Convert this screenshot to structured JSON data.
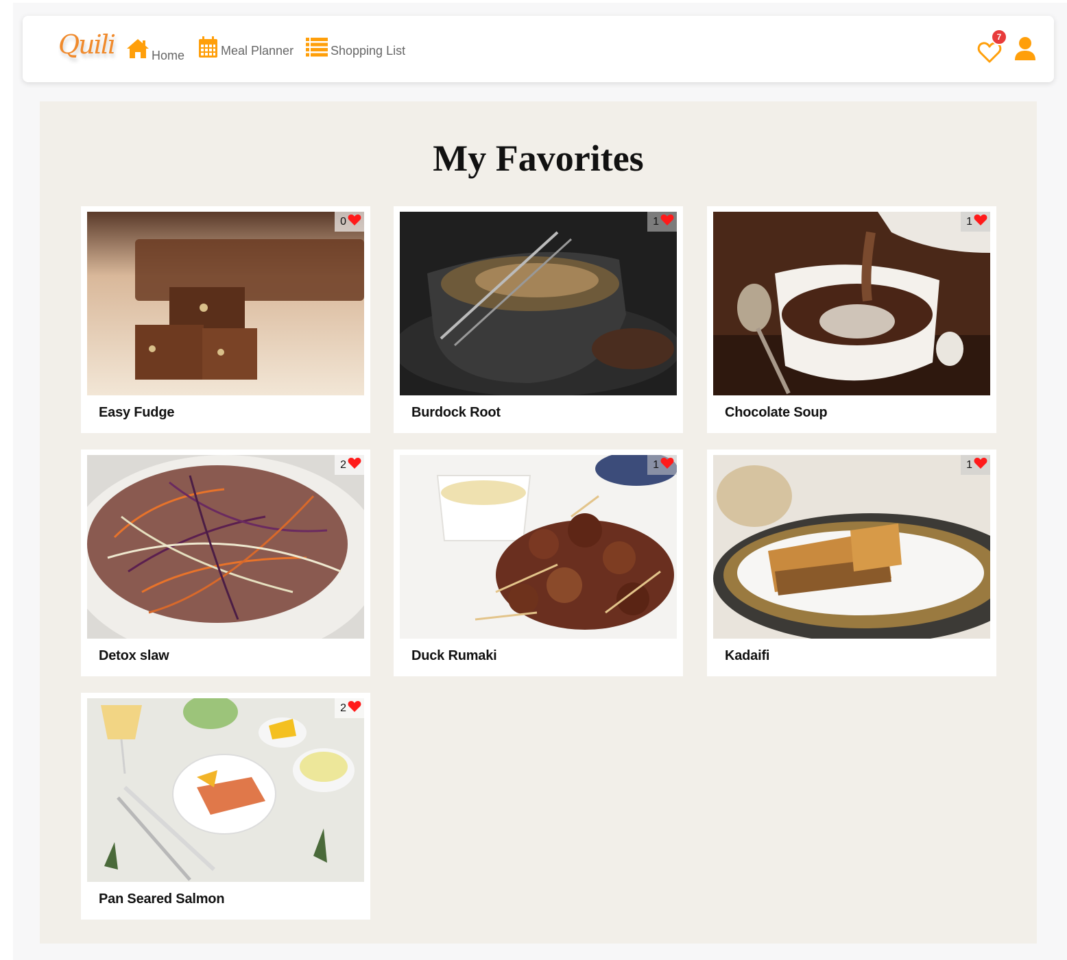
{
  "nav": {
    "logo_text": "Quili",
    "home_label": "Home",
    "meal_planner_label": "Meal Planner",
    "shopping_list_label": "Shopping List",
    "favorites_badge": "7",
    "accent_color": "#ff9f0a",
    "badge_color": "#e83b3b"
  },
  "page": {
    "title": "My Favorites"
  },
  "recipes": [
    {
      "name": "Easy Fudge",
      "likes": "0",
      "image": "chocolate-fudge-photo"
    },
    {
      "name": "Burdock Root",
      "likes": "1",
      "image": "burdock-root-bowl-photo"
    },
    {
      "name": "Chocolate Soup",
      "likes": "1",
      "image": "chocolate-soup-cup-photo"
    },
    {
      "name": "Detox slaw",
      "likes": "2",
      "image": "detox-slaw-photo"
    },
    {
      "name": "Duck Rumaki",
      "likes": "1",
      "image": "duck-rumaki-photo"
    },
    {
      "name": "Kadaifi",
      "likes": "1",
      "image": "kadaifi-pastry-photo"
    },
    {
      "name": "Pan Seared Salmon",
      "likes": "2",
      "image": "pan-seared-salmon-photo"
    }
  ]
}
